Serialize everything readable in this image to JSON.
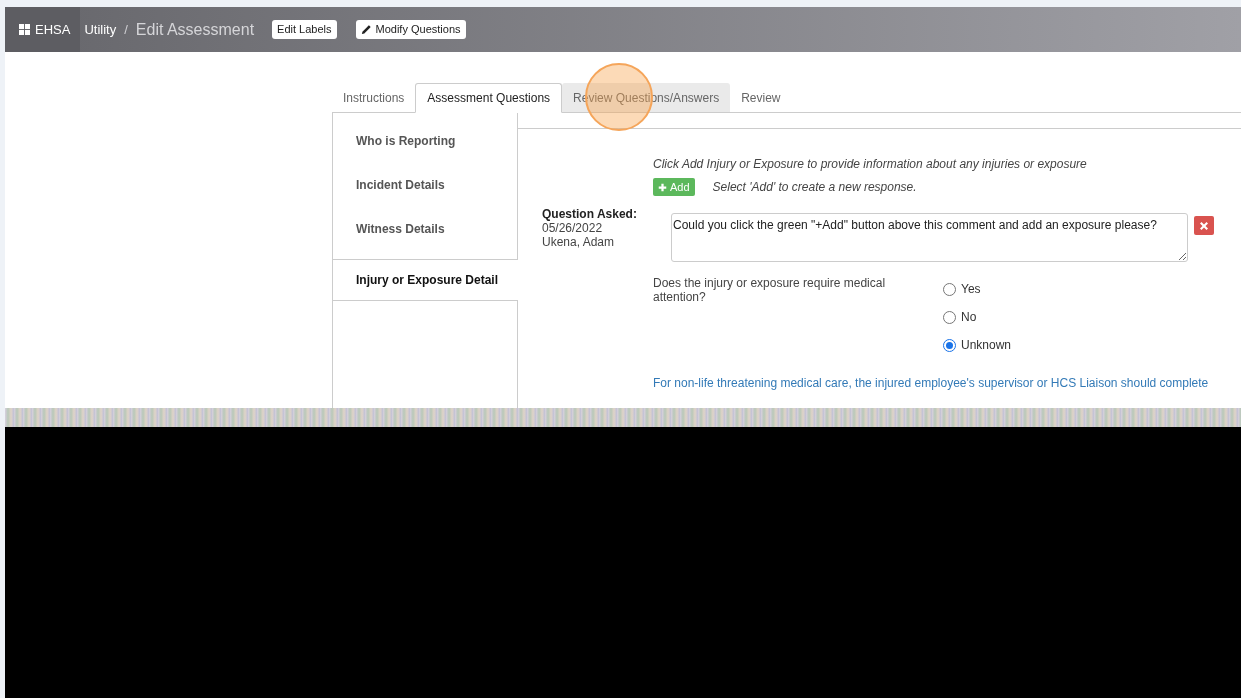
{
  "header": {
    "brand": "EHSA",
    "breadcrumb": "Utility",
    "separator": "/",
    "title": "Edit Assessment",
    "buttons": [
      {
        "label": "Edit Labels",
        "icon": false
      },
      {
        "label": "Modify Questions",
        "icon": true
      }
    ]
  },
  "tabs": [
    {
      "label": "Instructions",
      "selected": false,
      "hovered": false
    },
    {
      "label": "Assessment Questions",
      "selected": true,
      "hovered": false
    },
    {
      "label": "Review Questions/Answers",
      "selected": false,
      "hovered": true
    },
    {
      "label": "Review",
      "selected": false,
      "hovered": false
    }
  ],
  "sidebar": {
    "items": [
      {
        "label": "Who is Reporting",
        "selected": false
      },
      {
        "label": "Incident Details",
        "selected": false
      },
      {
        "label": "Witness Details",
        "selected": false
      },
      {
        "label": "Injury or Exposure Detail",
        "selected": true
      }
    ]
  },
  "question": {
    "instruction": "Click Add Injury or Exposure to provide information about any injuries or exposure",
    "add_button": "Add",
    "add_hint": "Select 'Add' to create a new response.",
    "asked_label": "Question Asked:",
    "asked_date": "05/26/2022",
    "asked_by": "Ukena, Adam",
    "comment": "Could you click the green \"+Add\" button above this comment and add an exposure please?",
    "prompt": "Does the injury or exposure require medical attention?",
    "options": [
      {
        "label": "Yes",
        "selected": false
      },
      {
        "label": "No",
        "selected": false
      },
      {
        "label": "Unknown",
        "selected": true
      }
    ],
    "note": "For non-life threatening medical care, the injured employee's supervisor or HCS Liaison should complete"
  }
}
